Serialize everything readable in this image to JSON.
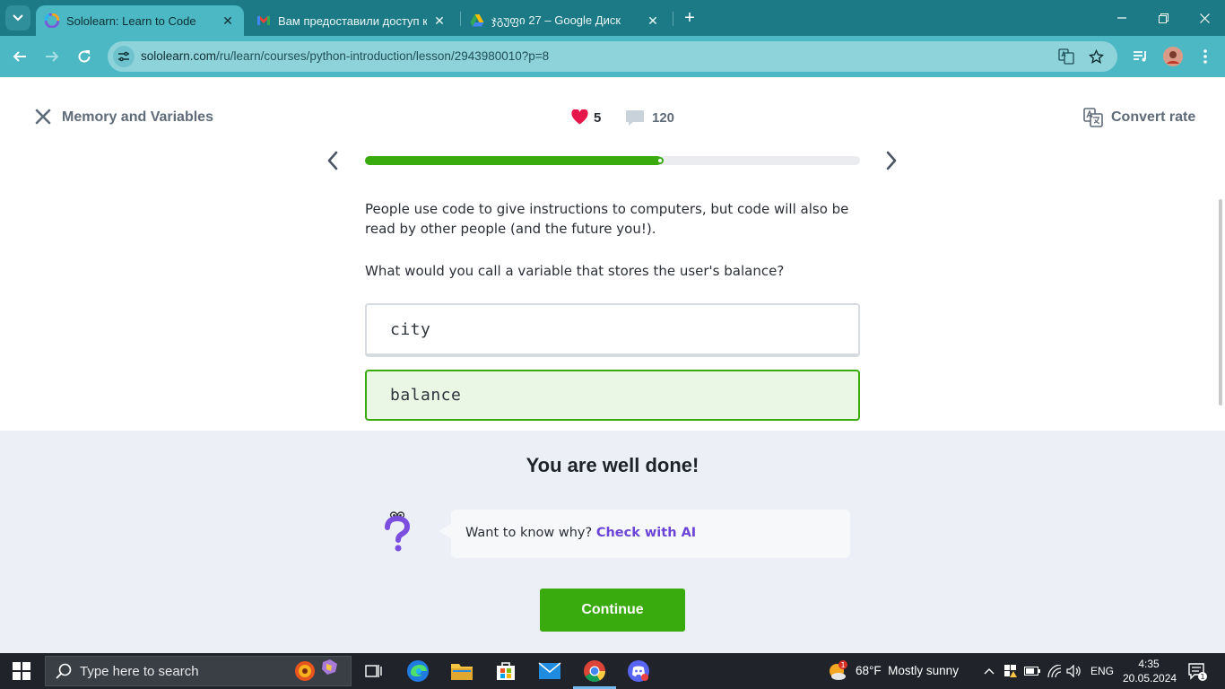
{
  "browser": {
    "tabs": [
      {
        "title": "Sololearn: Learn to Code",
        "active": true,
        "icon": "sololearn-icon"
      },
      {
        "title": "Вам предоставили доступ к па",
        "active": false,
        "icon": "gmail-icon"
      },
      {
        "title": "ჯგუფი 27 – Google Диск",
        "active": false,
        "icon": "google-drive-icon"
      }
    ],
    "new_tab_label": "+",
    "url_host": "sololearn.com",
    "url_path": "/ru/learn/courses/python-introduction/lesson/2943980010?p=8"
  },
  "lesson": {
    "title": "Memory and Variables",
    "hearts": "5",
    "comments": "120",
    "convert_label": "Convert rate",
    "progress_fraction": 0.6,
    "paragraph1": "People use code to give instructions to computers, but code will also be read by other people (and the future you!).",
    "question": "What would you call a variable that stores the user's balance?",
    "options": [
      {
        "text": "city",
        "state": "neutral"
      },
      {
        "text": "balance",
        "state": "correct"
      }
    ]
  },
  "feedback": {
    "title": "You are well done!",
    "prompt": "Want to know why?",
    "link": "Check with AI",
    "continue_label": "Continue"
  },
  "taskbar": {
    "search_placeholder": "Type here to search",
    "weather": "68°F  Mostly sunny",
    "weather_badge": "1",
    "language": "ENG",
    "time": "4:35",
    "date": "20.05.2024",
    "notification_count": "1"
  },
  "colors": {
    "chrome_dark": "#1b7a86",
    "chrome_light": "#4bb8c4",
    "success_green": "#3aab0f",
    "ai_purple": "#6b46d6",
    "heart_red": "#e8174b"
  }
}
